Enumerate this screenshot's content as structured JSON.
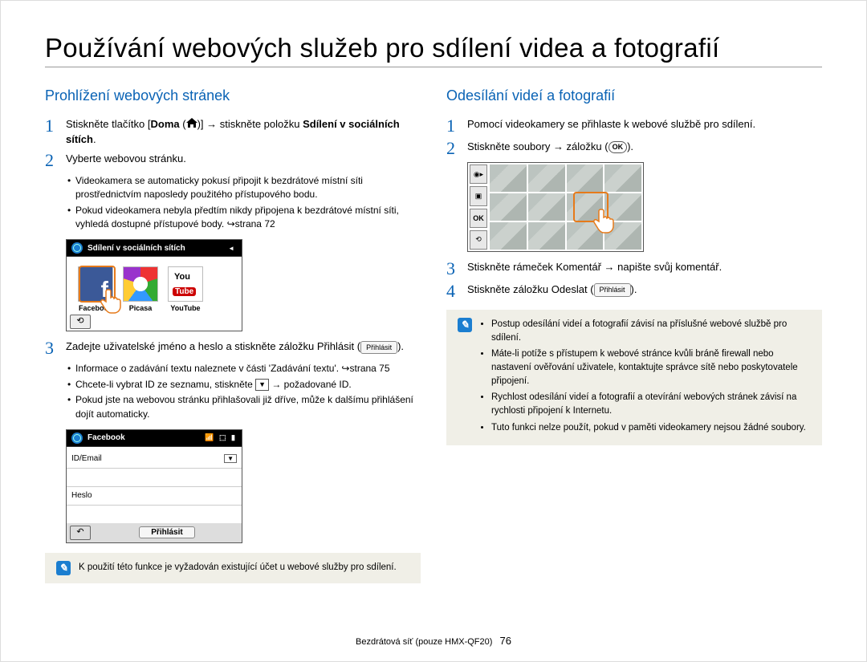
{
  "title": "Používání webových služeb pro sdílení videa a fotografií",
  "left": {
    "heading": "Prohlížení webových stránek",
    "step1_a": "Stiskněte tlačítko [",
    "step1_b": "Doma",
    "step1_c": " (",
    "step1_d": ")] → stiskněte položku ",
    "step1_e": "Sdílení v sociálních sítích",
    "step1_f": ".",
    "step2": "Vyberte webovou stránku.",
    "step2_sub1": "Videokamera se automaticky pokusí připojit k bezdrátové místní síti prostřednictvím naposledy použitého přístupového bodu.",
    "step2_sub2": "Pokud videokamera nebyla předtím nikdy připojena k bezdrátové místní síti, vyhledá dostupné přístupové body. ↪strana 72",
    "shot1": {
      "title": "Sdílení v sociálních sítích",
      "apps": [
        "Facebook",
        "Picasa",
        "YouTube"
      ],
      "back_icon": "back"
    },
    "step3_a": "Zadejte uživatelské jméno a heslo a stiskněte záložku Přihlásit (",
    "step3_b": ").",
    "step3_sub1": "Informace o zadávání textu naleznete v části 'Zadávání textu'. ↪strana 75",
    "step3_sub2_a": "Chcete-li vybrat ID ze seznamu, stiskněte ",
    "step3_sub2_b": " → požadované ID.",
    "step3_sub3": "Pokud jste na webovou stránku přihlašovali již dříve, může k dalšímu přihlášení dojít automaticky.",
    "shot2": {
      "title": "Facebook",
      "id_label": "ID/Email",
      "pw_label": "Heslo",
      "login_btn": "Přihlásit"
    },
    "note": "K použití této funkce je vyžadován existující účet u webové služby pro sdílení.",
    "login_pill": "Přihlásit"
  },
  "right": {
    "heading": "Odesílání videí a fotografií",
    "step1": "Pomocí videokamery se přihlaste k webové službě pro sdílení.",
    "step2_a": "Stiskněte soubory → záložku (",
    "step2_b": ").",
    "ok_label": "OK",
    "step3": "Stiskněte rámeček Komentář → napište svůj komentář.",
    "step4_a": "Stiskněte záložku Odeslat (",
    "step4_b": ").",
    "send_pill": "Přihlásit",
    "note_items": [
      "Postup odesílání videí a fotografií závisí na příslušné webové službě pro sdílení.",
      "Máte-li potíže s přístupem k webové stránce kvůli bráně firewall nebo nastavení ověřování uživatele, kontaktujte správce sítě nebo poskytovatele připojení.",
      "Rychlost odesílání videí a fotografií a otevírání webových stránek závisí na rychlosti připojení k Internetu.",
      "Tuto funkci nelze použít, pokud v paměti videokamery nejsou žádné soubory."
    ]
  },
  "footer": {
    "text": "Bezdrátová síť (pouze HMX-QF20)",
    "page": "76"
  }
}
